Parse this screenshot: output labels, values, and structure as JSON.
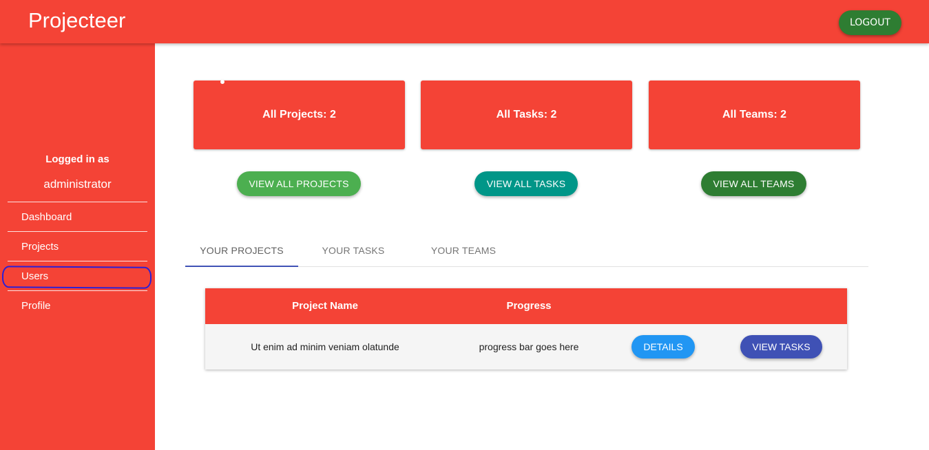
{
  "header": {
    "brand": "Projecteer",
    "logout_label": "LOGOUT"
  },
  "sidebar": {
    "logged_in_label": "Logged in as",
    "username": "administrator",
    "items": [
      {
        "label": "Dashboard"
      },
      {
        "label": "Projects"
      },
      {
        "label": "Users"
      },
      {
        "label": "Profile"
      }
    ]
  },
  "stats": [
    {
      "label": "All Projects: 2",
      "button": "VIEW ALL PROJECTS",
      "button_color": "#4caf50"
    },
    {
      "label": "All Tasks: 2",
      "button": "VIEW ALL TASKS",
      "button_color": "#009688"
    },
    {
      "label": "All Teams: 2",
      "button": "VIEW ALL TEAMS",
      "button_color": "#2e7d32"
    }
  ],
  "tabs": [
    {
      "label": "YOUR PROJECTS",
      "active": true
    },
    {
      "label": "YOUR TASKS",
      "active": false
    },
    {
      "label": "YOUR TEAMS",
      "active": false
    }
  ],
  "table": {
    "columns": [
      "Project Name",
      "Progress"
    ],
    "rows": [
      {
        "name": "Ut enim ad minim veniam olatunde",
        "progress": "progress bar goes here",
        "details_label": "DETAILS",
        "view_tasks_label": "VIEW TASKS"
      }
    ]
  },
  "colors": {
    "primary": "#f44336",
    "details_button": "#2196f3",
    "view_tasks_button": "#3f51b5",
    "logout_button": "#2e7d32",
    "tab_indicator": "#3f51b5"
  }
}
